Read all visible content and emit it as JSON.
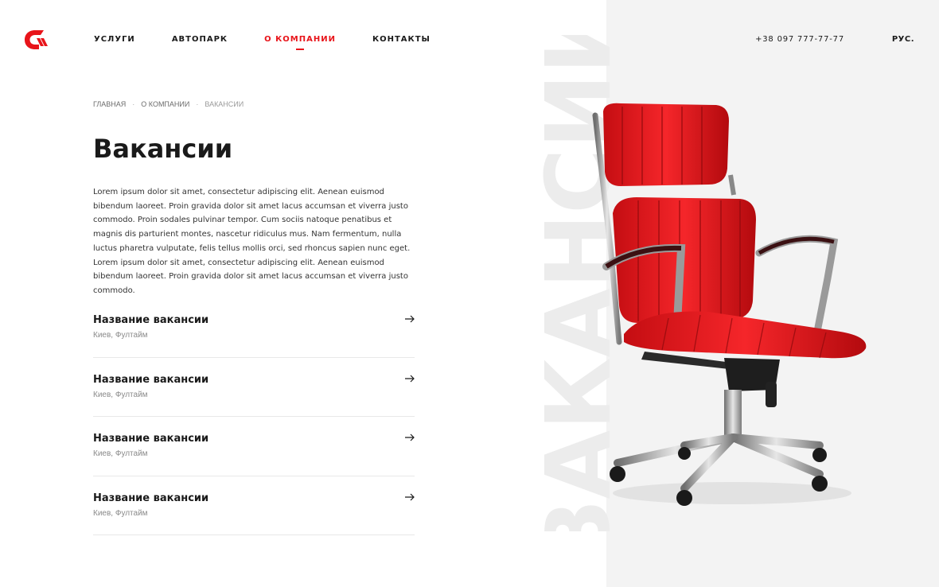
{
  "header": {
    "logo_icon": "brand-logo-c",
    "nav": [
      {
        "label": "УСЛУГИ",
        "active": false
      },
      {
        "label": "АВТОПАРК",
        "active": false
      },
      {
        "label": "О КОМПАНИИ",
        "active": true
      },
      {
        "label": "КОНТАКТЫ",
        "active": false
      }
    ],
    "phone": "+38 097 777-77-77",
    "language": "РУС."
  },
  "breadcrumb": {
    "items": [
      "ГЛАВНАЯ",
      "О КОМПАНИИ",
      "ВАКАНСИИ"
    ],
    "separator": "·"
  },
  "page": {
    "title": "Вакансии",
    "intro": "Lorem ipsum dolor sit amet, consectetur adipiscing elit. Aenean euismod bibendum laoreet. Proin gravida dolor sit amet lacus accumsan et viverra justo commodo. Proin sodales pulvinar tempor. Cum sociis natoque penatibus et magnis dis parturient montes, nascetur ridiculus mus. Nam fermentum, nulla luctus pharetra vulputate, felis tellus mollis orci, sed rhoncus sapien nunc eget. Lorem ipsum dolor sit amet, consectetur adipiscing elit. Aenean euismod bibendum laoreet. Proin gravida dolor sit amet lacus accumsan et viverra justo commodo."
  },
  "vacancies": [
    {
      "title": "Название вакансии",
      "meta": "Киев, Фултайм",
      "icon": "arrow-right-icon"
    },
    {
      "title": "Название вакансии",
      "meta": "Киев, Фултайм",
      "icon": "arrow-right-icon"
    },
    {
      "title": "Название вакансии",
      "meta": "Киев, Фултайм",
      "icon": "arrow-right-icon"
    },
    {
      "title": "Название вакансии",
      "meta": "Киев, Фултайм",
      "icon": "arrow-right-icon"
    }
  ],
  "hero": {
    "watermark": "ВАКАНСИИ",
    "image": "red-office-chair"
  },
  "colors": {
    "accent": "#e8141a",
    "text": "#1a1a1a",
    "muted": "#8a8a8a",
    "panel": "#f3f3f3"
  }
}
